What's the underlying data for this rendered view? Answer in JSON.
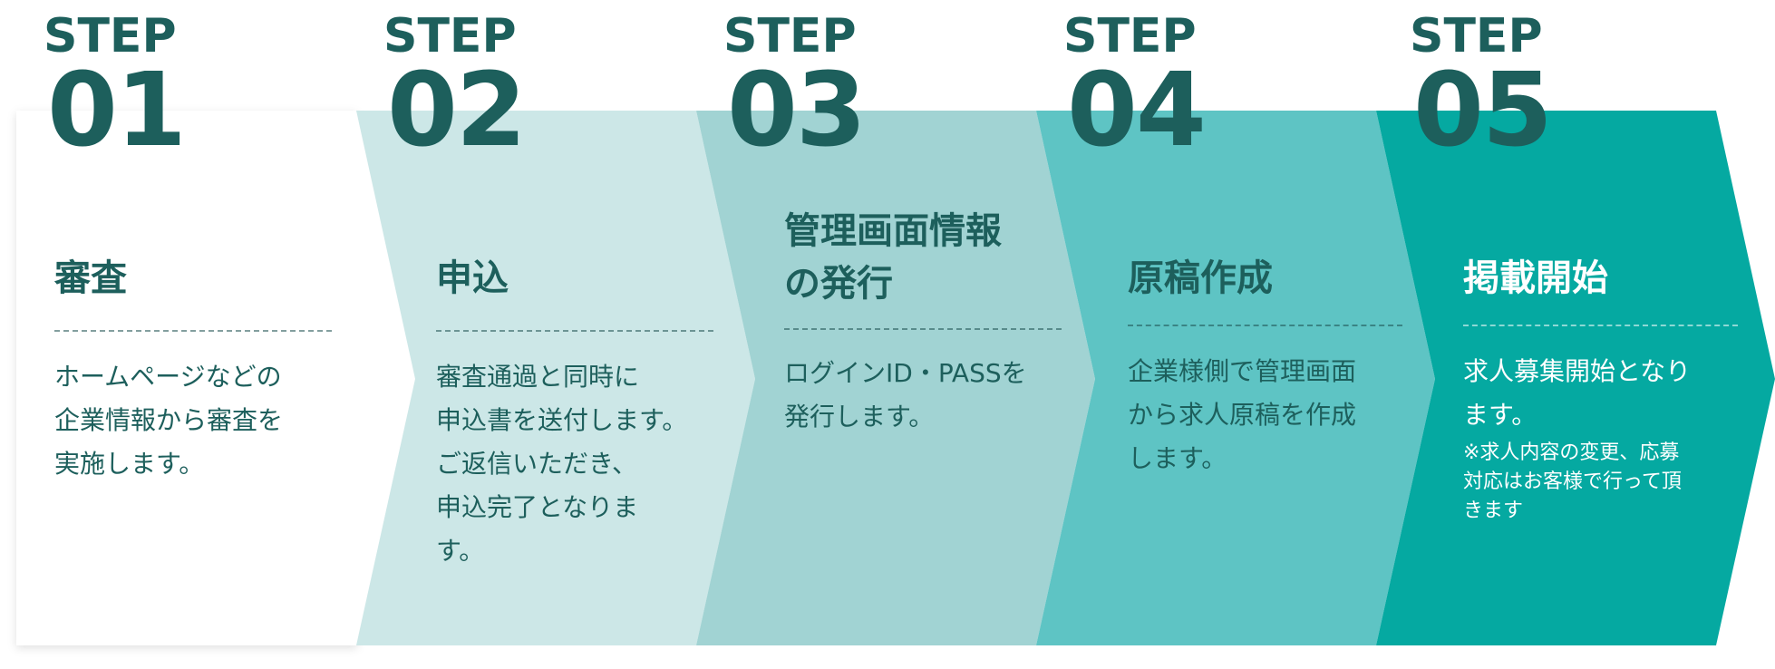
{
  "steps": [
    {
      "step_word": "STEP",
      "number": "01",
      "title": "審査",
      "description": "ホームページなどの\n企業情報から審査を\n実施します。",
      "note": ""
    },
    {
      "step_word": "STEP",
      "number": "02",
      "title": "申込",
      "description": "審査通過と同時に\n申込書を送付します。\nご返信いただき、\n申込完了となりま\nす。",
      "note": ""
    },
    {
      "step_word": "STEP",
      "number": "03",
      "title": "管理画面情報\nの発行",
      "description": "ログインID・PASSを\n発行します。",
      "note": ""
    },
    {
      "step_word": "STEP",
      "number": "04",
      "title": "原稿作成",
      "description": "企業様側で管理画面\nから求人原稿を作成\nします。",
      "note": ""
    },
    {
      "step_word": "STEP",
      "number": "05",
      "title": "掲載開始",
      "description": "求人募集開始となり\nます。",
      "note": "※求人内容の変更、応募\n対応はお客様で行って頂\nきます"
    }
  ],
  "colors": {
    "panel_1": "#ffffff",
    "panel_2": "#cce7e7",
    "panel_3": "#a1d3d3",
    "panel_4": "#5ec4c4",
    "panel_5": "#05a9a1",
    "heading": "#1d5f5c",
    "text_on_dark": "#ffffff"
  }
}
